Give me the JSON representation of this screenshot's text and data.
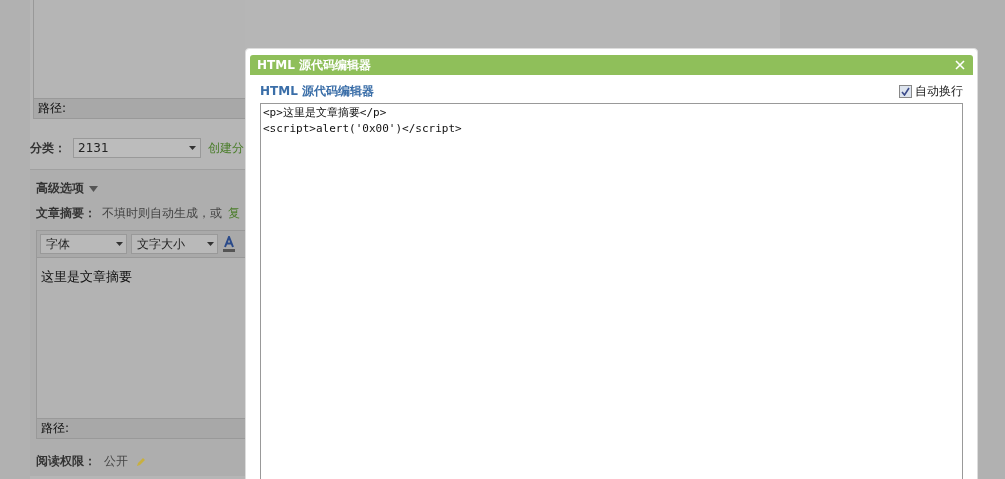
{
  "top_editor": {
    "path_label": "路径:"
  },
  "category": {
    "label": "分类：",
    "value": "2131",
    "link": "创建分"
  },
  "advanced": {
    "title": "高级选项",
    "expanded": true,
    "summary": {
      "label": "文章摘要：",
      "hint": "不填时则自动生成，或",
      "link": "复"
    },
    "toolbar": {
      "font": "字体",
      "size": "文字大小"
    },
    "content": "这里是文章摘要",
    "path_label": "路径:",
    "permission": {
      "label": "阅读权限：",
      "value": "公开"
    }
  },
  "dialog": {
    "title": "HTML 源代码编辑器",
    "heading": "HTML 源代码编辑器",
    "wrap": {
      "label": "自动换行",
      "checked": true
    },
    "code": "<p>这里是文章摘要</p>\n<script>alert('0x00')</script>"
  }
}
